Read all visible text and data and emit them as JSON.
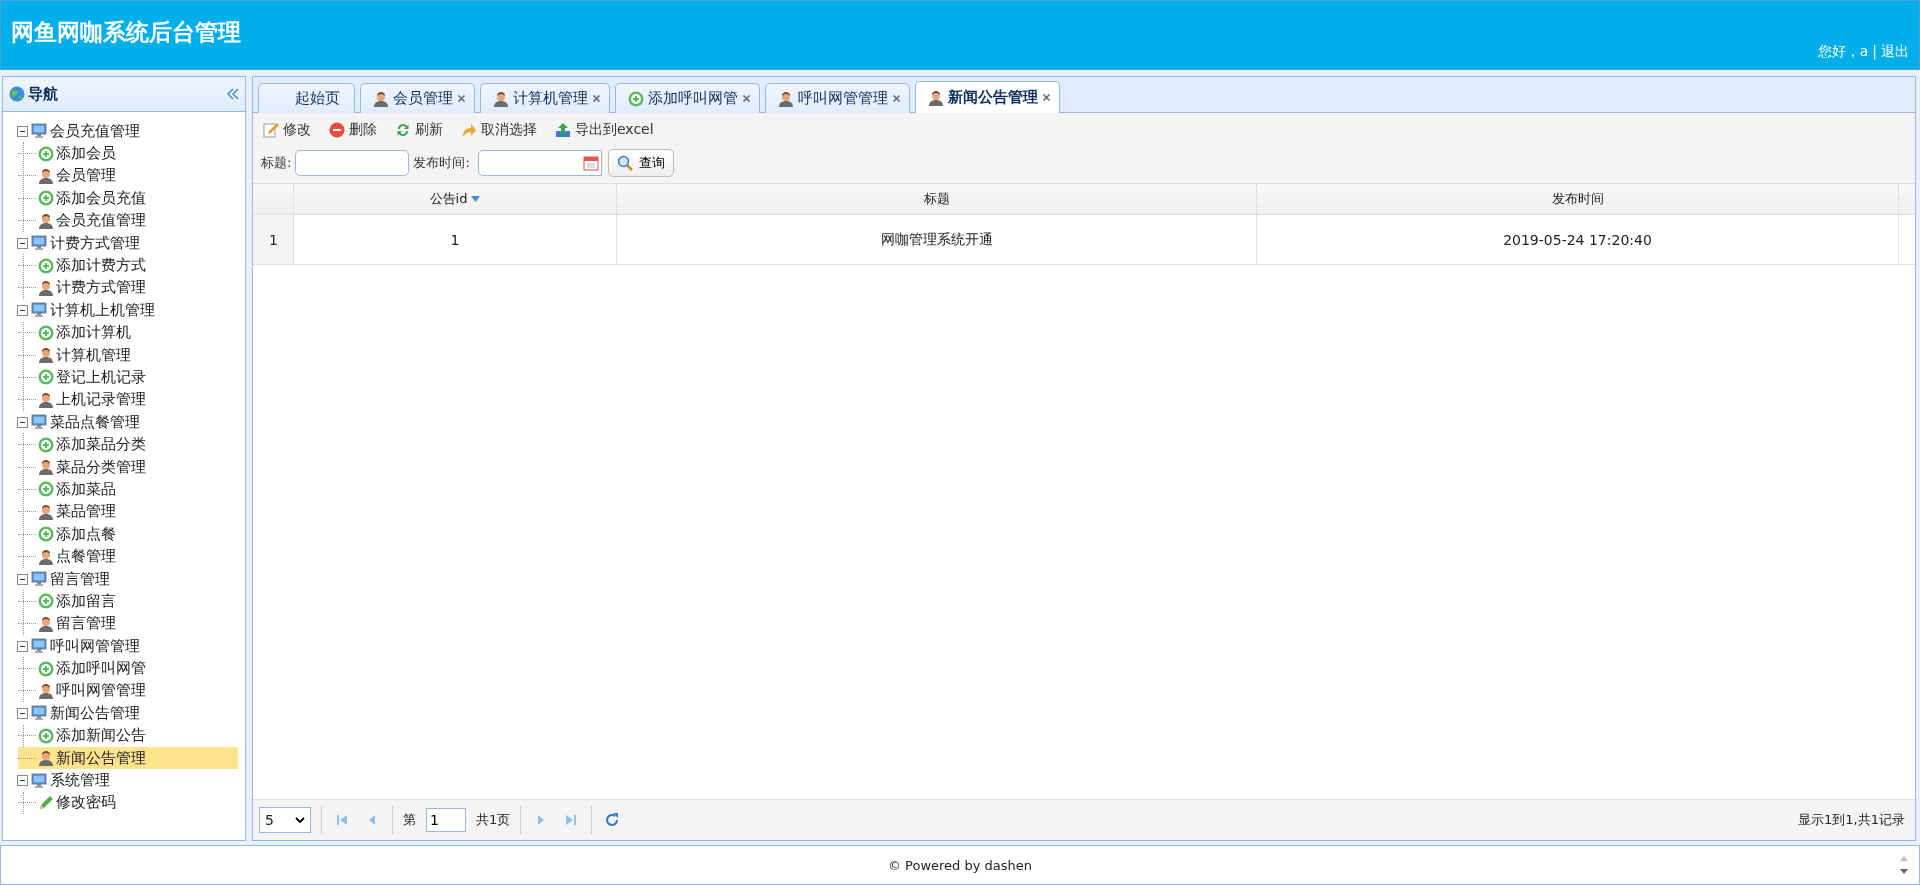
{
  "header": {
    "title": "网鱼网咖系统后台管理",
    "greeting": "您好，a",
    "separator": "|",
    "logout": "退出"
  },
  "nav": {
    "title": "导航",
    "tree": [
      {
        "label": "会员充值管理",
        "expanded": true,
        "children": [
          {
            "label": "添加会员",
            "kind": "add",
            "selected": false
          },
          {
            "label": "会员管理",
            "kind": "user",
            "selected": false
          },
          {
            "label": "添加会员充值",
            "kind": "add",
            "selected": false
          },
          {
            "label": "会员充值管理",
            "kind": "user",
            "selected": false
          }
        ]
      },
      {
        "label": "计费方式管理",
        "expanded": true,
        "children": [
          {
            "label": "添加计费方式",
            "kind": "add",
            "selected": false
          },
          {
            "label": "计费方式管理",
            "kind": "user",
            "selected": false
          }
        ]
      },
      {
        "label": "计算机上机管理",
        "expanded": true,
        "children": [
          {
            "label": "添加计算机",
            "kind": "add",
            "selected": false
          },
          {
            "label": "计算机管理",
            "kind": "user",
            "selected": false
          },
          {
            "label": "登记上机记录",
            "kind": "add",
            "selected": false
          },
          {
            "label": "上机记录管理",
            "kind": "user",
            "selected": false
          }
        ]
      },
      {
        "label": "菜品点餐管理",
        "expanded": true,
        "children": [
          {
            "label": "添加菜品分类",
            "kind": "add",
            "selected": false
          },
          {
            "label": "菜品分类管理",
            "kind": "user",
            "selected": false
          },
          {
            "label": "添加菜品",
            "kind": "add",
            "selected": false
          },
          {
            "label": "菜品管理",
            "kind": "user",
            "selected": false
          },
          {
            "label": "添加点餐",
            "kind": "add",
            "selected": false
          },
          {
            "label": "点餐管理",
            "kind": "user",
            "selected": false
          }
        ]
      },
      {
        "label": "留言管理",
        "expanded": true,
        "children": [
          {
            "label": "添加留言",
            "kind": "add",
            "selected": false
          },
          {
            "label": "留言管理",
            "kind": "user",
            "selected": false
          }
        ]
      },
      {
        "label": "呼叫网管管理",
        "expanded": true,
        "children": [
          {
            "label": "添加呼叫网管",
            "kind": "add",
            "selected": false
          },
          {
            "label": "呼叫网管管理",
            "kind": "user",
            "selected": false
          }
        ]
      },
      {
        "label": "新闻公告管理",
        "expanded": true,
        "children": [
          {
            "label": "添加新闻公告",
            "kind": "add",
            "selected": false
          },
          {
            "label": "新闻公告管理",
            "kind": "user",
            "selected": true
          }
        ]
      },
      {
        "label": "系统管理",
        "expanded": true,
        "children": [
          {
            "label": "修改密码",
            "kind": "edit",
            "selected": false
          }
        ]
      }
    ]
  },
  "tabs": [
    {
      "label": "起始页",
      "kind": "none",
      "closable": false,
      "selected": false
    },
    {
      "label": "会员管理",
      "kind": "user",
      "closable": true,
      "selected": false
    },
    {
      "label": "计算机管理",
      "kind": "user",
      "closable": true,
      "selected": false
    },
    {
      "label": "添加呼叫网管",
      "kind": "add",
      "closable": true,
      "selected": false
    },
    {
      "label": "呼叫网管管理",
      "kind": "user",
      "closable": true,
      "selected": false
    },
    {
      "label": "新闻公告管理",
      "kind": "user",
      "closable": true,
      "selected": true
    }
  ],
  "toolbar": [
    {
      "label": "修改",
      "kind": "edit"
    },
    {
      "label": "删除",
      "kind": "delete"
    },
    {
      "label": "刷新",
      "kind": "refresh"
    },
    {
      "label": "取消选择",
      "kind": "undo"
    },
    {
      "label": "导出到excel",
      "kind": "export"
    }
  ],
  "search": {
    "title_label": "标题:",
    "date_label": "发布时间:",
    "button": "查询"
  },
  "table": {
    "columns": [
      {
        "label": "公告id",
        "sorted": true
      },
      {
        "label": "标题",
        "sorted": false
      },
      {
        "label": "发布时间",
        "sorted": false
      }
    ],
    "rows": [
      {
        "number": "1",
        "cells": [
          "1",
          "网咖管理系统开通",
          "2019-05-24 17:20:40"
        ]
      }
    ]
  },
  "pager": {
    "page_size": "5",
    "page_prefix": "第",
    "page": "1",
    "page_suffix": "共1页",
    "summary": "显示1到1,共1记录"
  },
  "footer": {
    "text": "© Powered by dashen"
  }
}
